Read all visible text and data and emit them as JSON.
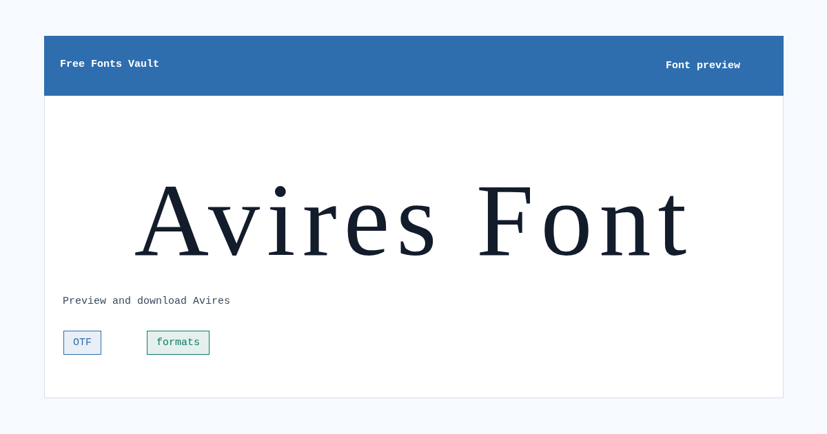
{
  "header": {
    "title": "Free Fonts Vault",
    "label": "Font preview"
  },
  "specimen": {
    "text": "Avires Font"
  },
  "description": "Preview and download Avires",
  "tags": [
    {
      "label": "OTF",
      "color": "#2f6eae"
    },
    {
      "label": "formats",
      "color": "#0f7a66"
    }
  ]
}
